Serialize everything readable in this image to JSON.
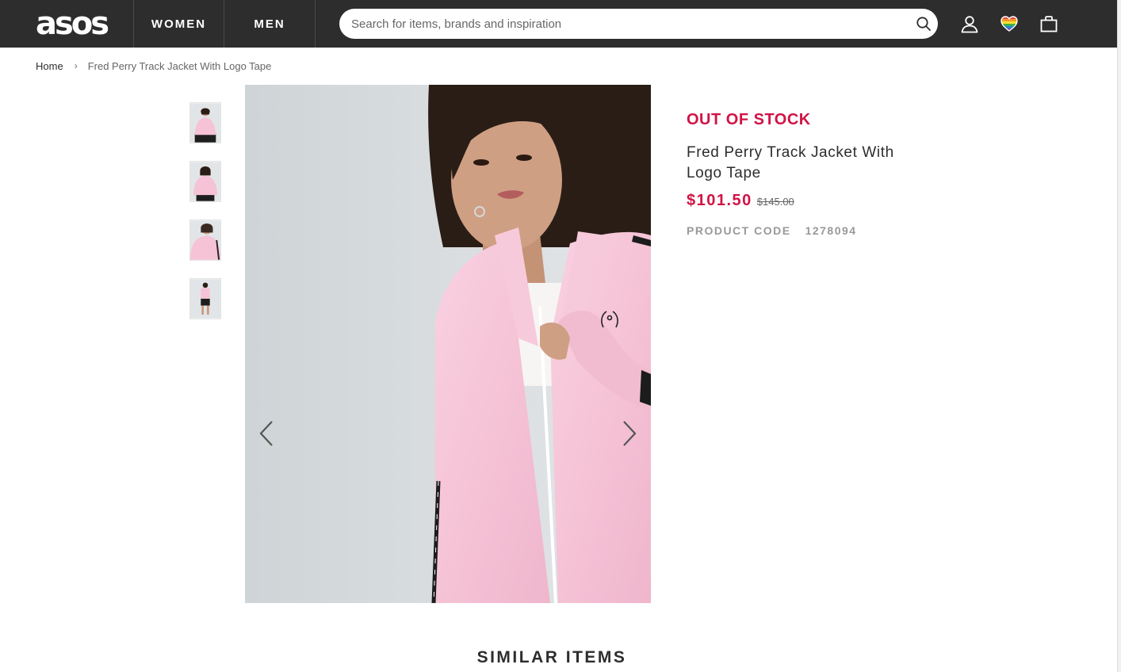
{
  "header": {
    "logo_text": "asos",
    "nav": [
      {
        "label": "WOMEN"
      },
      {
        "label": "MEN"
      }
    ],
    "search": {
      "placeholder": "Search for items, brands and inspiration",
      "value": ""
    },
    "icons": [
      "search-icon",
      "account-icon",
      "saved-items-heart-icon",
      "bag-icon"
    ]
  },
  "breadcrumb": {
    "home": "Home",
    "separator": "›",
    "current": "Fred Perry Track Jacket With Logo Tape"
  },
  "gallery": {
    "thumbnail_count": 4,
    "prev_icon": "chevron-left-icon",
    "next_icon": "chevron-right-icon"
  },
  "product": {
    "stock_status": "OUT OF STOCK",
    "title": "Fred Perry Track Jacket With Logo Tape",
    "price_current": "$101.50",
    "price_previous": "$145.00",
    "code_label": "PRODUCT CODE",
    "code_value": "1278094"
  },
  "similar": {
    "heading": "SIMILAR ITEMS"
  },
  "colors": {
    "header_bg": "#2d2d2d",
    "accent_red": "#d01345",
    "jacket_pink": "#f6c6d8",
    "backdrop_grey": "#d8dcde"
  }
}
